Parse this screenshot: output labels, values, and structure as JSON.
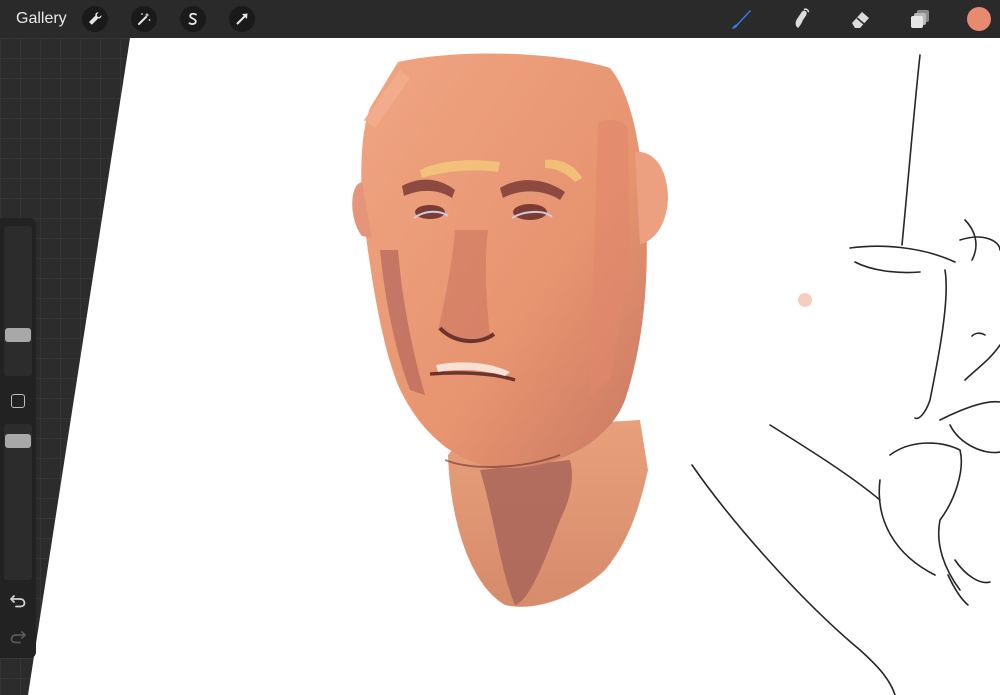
{
  "topbar": {
    "gallery_label": "Gallery",
    "left_tools": [
      {
        "icon": "wrench-icon"
      },
      {
        "icon": "magic-wand-icon"
      },
      {
        "icon": "selection-s-icon"
      },
      {
        "icon": "transform-arrow-icon"
      }
    ],
    "right_tools": [
      {
        "icon": "brush-icon",
        "active_color": "#2f7ff5"
      },
      {
        "icon": "smudge-icon"
      },
      {
        "icon": "eraser-icon"
      },
      {
        "icon": "layers-icon"
      }
    ],
    "current_color": "#e88a70"
  },
  "sidebar": {
    "brush_size_slider": {
      "icon": "brush-size-slider"
    },
    "modify_button": {
      "icon": "square-icon"
    },
    "opacity_slider": {
      "icon": "opacity-slider"
    },
    "undo": {
      "icon": "undo-icon"
    },
    "redo": {
      "icon": "redo-icon",
      "enabled": false
    }
  },
  "canvas": {
    "background": "#ffffff",
    "artwork": "painted-portrait-and-line-sketch"
  }
}
